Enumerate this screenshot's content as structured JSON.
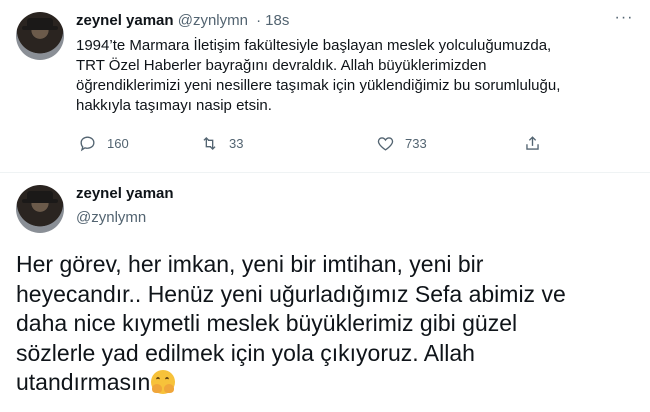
{
  "tweet1": {
    "name": "zeynel yaman",
    "handle": "@zynlymn",
    "separator": "·",
    "time": "18s",
    "body_lines": [
      "1994’te Marmara İletişim fakültesiyle başlayan meslek yolculuğumuzda,",
      "TRT Özel Haberler  bayrağını devraldık. Allah büyüklerimizden",
      "öğrendiklerimizi yeni nesillere taşımak için yüklendiğimiz bu sorumluluğu,",
      "hakkıyla taşımayı nasip etsin."
    ],
    "actions": {
      "reply_count": "160",
      "retweet_count": "33",
      "like_count": "733"
    },
    "more_label": "···"
  },
  "tweet2": {
    "name": "zeynel yaman",
    "handle": "@zynlymn",
    "body_lines": [
      "Her görev, her imkan, yeni bir imtihan, yeni bir",
      "heyecandır.. Henüz yeni uğurladığımız Sefa abimiz ve",
      "daha nice kıymetli meslek büyüklerimiz gibi güzel",
      "sözlerle yad edilmek için yola çıkıyoruz. Allah",
      "utandırmasın"
    ],
    "emoji": "hugging-face"
  }
}
